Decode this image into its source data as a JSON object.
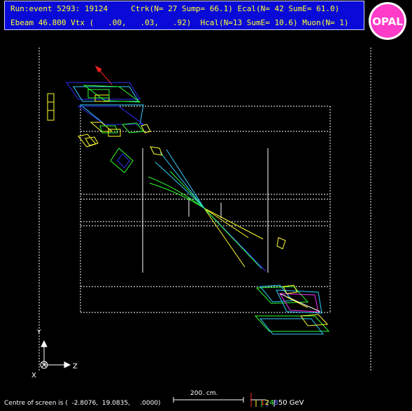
{
  "header": {
    "line1": "Run:event 5293: 19124     Ctrk(N= 27 Sump= 66.1) Ecal(N= 42 SumE= 61.0)",
    "line2": "Ebeam 46.800 Vtx (   .00,   .03,   .92)  Hcal(N=13 SumE= 10.6) Muon(N= 1)"
  },
  "logo": {
    "text": "OPAL",
    "fill": "#ff3cc8",
    "ring": "#ffffff"
  },
  "axes": {
    "x_label": "X",
    "y_label": "Y",
    "z_label": "Z"
  },
  "footer": {
    "centre": "Centre of screen is (  -2.8076,  19.0835,     .0000)",
    "scale": "200. cm.",
    "energy_labels": [
      {
        "text": "1",
        "color": "#ff3030"
      },
      {
        "text": "2",
        "color": "#ffff30"
      },
      {
        "text": "4",
        "color": "#30ff30"
      },
      {
        "text": "8",
        "color": "#7070ff"
      },
      {
        "text": "50 GeV",
        "color": "#ffffff"
      }
    ]
  },
  "colors": {
    "background": "#000000",
    "header_bg": "#0a0ad8",
    "header_text": "#ffff30",
    "detector_lines": "#ffffff",
    "tracks_yellow": "#ffff30",
    "tracks_green": "#30ff30",
    "tracks_cyan": "#30d0ff",
    "tracks_blue": "#3030ff",
    "muon_red": "#ff2020",
    "magenta": "#ff30ff"
  }
}
